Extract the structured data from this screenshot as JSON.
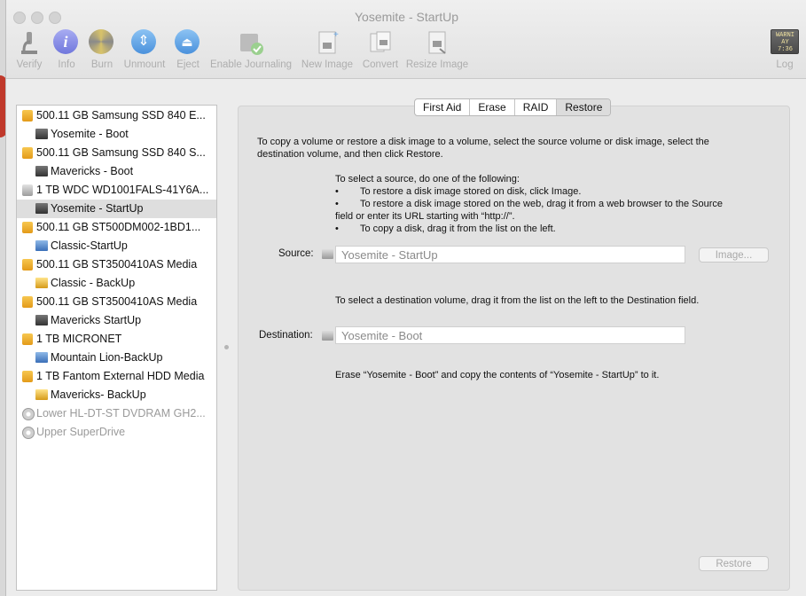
{
  "window": {
    "title": "Yosemite - StartUp"
  },
  "toolbar": {
    "verify": "Verify",
    "info": "Info",
    "burn": "Burn",
    "unmount": "Unmount",
    "eject": "Eject",
    "enable_journaling": "Enable Journaling",
    "new_image": "New Image",
    "convert": "Convert",
    "resize_image": "Resize Image",
    "log": "Log",
    "log_icon_text_1": "WARNI",
    "log_icon_text_2": "AY 7:36"
  },
  "sidebar": {
    "items": [
      {
        "label": "500.11 GB Samsung SSD 840 E...",
        "kind": "disk"
      },
      {
        "label": "Yosemite - Boot",
        "kind": "volume"
      },
      {
        "label": "500.11 GB Samsung SSD 840 S...",
        "kind": "disk"
      },
      {
        "label": "Mavericks - Boot",
        "kind": "volume"
      },
      {
        "label": "1 TB WDC WD1001FALS-41Y6A...",
        "kind": "disk"
      },
      {
        "label": "Yosemite - StartUp",
        "kind": "volume",
        "selected": true
      },
      {
        "label": "500.11 GB ST500DM002-1BD1...",
        "kind": "disk"
      },
      {
        "label": "Classic-StartUp",
        "kind": "volume"
      },
      {
        "label": "500.11 GB ST3500410AS Media",
        "kind": "disk"
      },
      {
        "label": "Classic - BackUp",
        "kind": "volume"
      },
      {
        "label": "500.11 GB ST3500410AS Media",
        "kind": "disk"
      },
      {
        "label": "Mavericks StartUp",
        "kind": "volume"
      },
      {
        "label": "1 TB MICRONET",
        "kind": "disk"
      },
      {
        "label": "Mountain Lion-BackUp",
        "kind": "volume"
      },
      {
        "label": "1 TB Fantom External HDD Media",
        "kind": "disk"
      },
      {
        "label": "Mavericks- BackUp",
        "kind": "volume"
      },
      {
        "label": "Lower HL-DT-ST DVDRAM GH2...",
        "kind": "optical"
      },
      {
        "label": "Upper SuperDrive",
        "kind": "optical"
      }
    ]
  },
  "tabs": [
    "First Aid",
    "Erase",
    "RAID",
    "Restore"
  ],
  "active_tab": "Restore",
  "restore": {
    "intro_line1": "To copy a volume or restore a disk image to a volume, select the source volume or disk image, select the",
    "intro_line2": "destination volume, and then click Restore.",
    "source_instructions": "To select a source, do one of the following:",
    "bullet1": "To restore a disk image stored on disk, click Image.",
    "bullet2_line1": "To restore a disk image stored on the web, drag it from a web browser to the Source",
    "bullet2_line2": "field or enter its URL starting with “http://”.",
    "bullet3": "To copy a disk, drag it from the list on the left.",
    "bullet_glyph": "•",
    "source_label": "Source:",
    "source_value": "Yosemite - StartUp",
    "image_button": "Image...",
    "destination_instructions": "To select a destination volume, drag it from the list on the left to the Destination field.",
    "destination_label": "Destination:",
    "destination_value": "Yosemite - Boot",
    "summary": "Erase “Yosemite - Boot” and copy the contents of “Yosemite - StartUp” to it.",
    "restore_button": "Restore"
  },
  "colors": {
    "accent_blue": "#5a9fe4",
    "info_purple": "#8a8fe6",
    "disk_orange": "#e9a526",
    "selected_row": "#dedede"
  }
}
